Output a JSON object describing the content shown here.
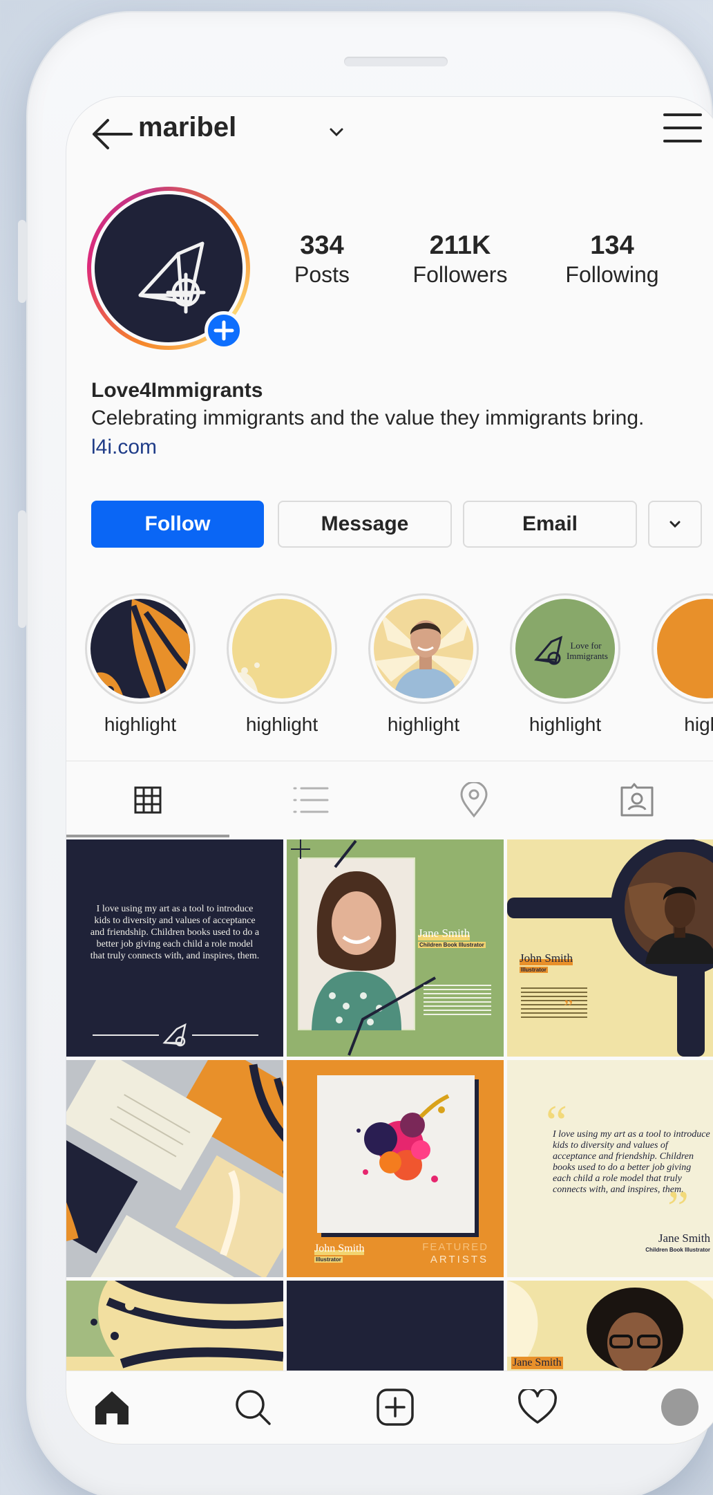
{
  "header": {
    "username": "maribel"
  },
  "profile": {
    "stats": [
      {
        "value": "334",
        "label": "Posts"
      },
      {
        "value": "211K",
        "label": "Followers"
      },
      {
        "value": "134",
        "label": "Following"
      }
    ],
    "name": "Love4Immigrants",
    "bio": "Celebrating immigrants and the value they immigrants bring.",
    "link": "l4i.com"
  },
  "actions": {
    "follow": "Follow",
    "message": "Message",
    "email": "Email"
  },
  "highlights": [
    {
      "label": "highlight",
      "image": "butterfly-wing-orange"
    },
    {
      "label": "highlight",
      "image": "yellow-wing"
    },
    {
      "label": "highlight",
      "image": "man-portrait"
    },
    {
      "label": "highlight",
      "image": "love-for-immigrants-logo",
      "logo_text": "Love for Immigrants"
    },
    {
      "label": "highli",
      "image": "orange-circle"
    }
  ],
  "tabs": [
    {
      "name": "grid",
      "icon": "grid-icon",
      "active": true
    },
    {
      "name": "list",
      "icon": "list-icon",
      "active": false
    },
    {
      "name": "location",
      "icon": "location-pin-icon",
      "active": false
    },
    {
      "name": "tagged",
      "icon": "tagged-person-icon",
      "active": false
    }
  ],
  "posts": {
    "post1": {
      "quote": "I love using my art as a tool to introduce kids to diversity and values of acceptance and friendship. Children books used to do a better job giving each child a role model that truly connects with, and inspires, them."
    },
    "post2": {
      "name": "Jane Smith",
      "title": "Children Book Illustrator"
    },
    "post3": {
      "name": "John Smith",
      "title": "Illustrator"
    },
    "post5": {
      "name": "John Smith",
      "title": "Illustrator",
      "featured": "FEATURED",
      "artists": "ARTISTS"
    },
    "post6": {
      "quote": "I love using my art as a tool to introduce kids to diversity and values of acceptance and friendship. Children books used to do a better job giving each child a role model that truly connects with, and inspires, them.",
      "name": "Jane Smith",
      "title": "Children Book Illustrator"
    },
    "post9": {
      "name": "Jane Smith"
    }
  },
  "colors": {
    "navy": "#1f2238",
    "orange": "#e8902a",
    "sage": "#93b26e",
    "cream": "#f1e3a6",
    "follow_blue": "#0a66f5"
  },
  "nav": [
    {
      "name": "home",
      "icon": "home-icon"
    },
    {
      "name": "search",
      "icon": "search-icon"
    },
    {
      "name": "new-post",
      "icon": "add-post-icon"
    },
    {
      "name": "activity",
      "icon": "heart-icon"
    },
    {
      "name": "profile",
      "icon": "profile-avatar-icon"
    }
  ]
}
